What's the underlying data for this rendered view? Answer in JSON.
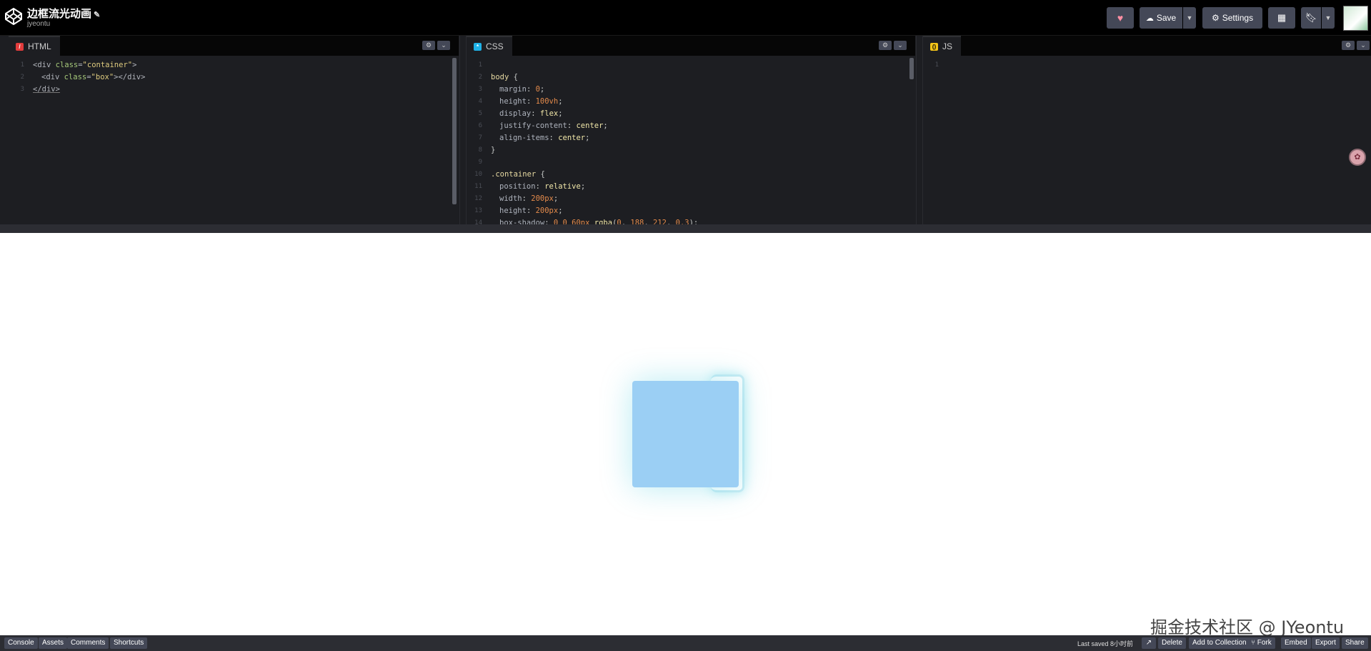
{
  "header": {
    "title": "边框流光动画",
    "author": "jyeontu",
    "save_label": "Save",
    "settings_label": "Settings"
  },
  "editors": {
    "html": {
      "label": "HTML",
      "lines": [
        "1",
        "2",
        "3"
      ]
    },
    "css": {
      "label": "CSS",
      "lines": [
        "1",
        "2",
        "3",
        "4",
        "5",
        "6",
        "7",
        "8",
        "9",
        "10",
        "11",
        "12",
        "13",
        "14"
      ]
    },
    "js": {
      "label": "JS",
      "lines": [
        "1"
      ]
    }
  },
  "preview": {
    "watermark": "掘金技术社区 @ JYeontu"
  },
  "footer": {
    "console": "Console",
    "assets": "Assets",
    "comments": "Comments",
    "shortcuts": "Shortcuts",
    "last_saved": "Last saved 8小时前",
    "delete": "Delete",
    "add_to_collection": "Add to Collection",
    "fork": "Fork",
    "embed": "Embed",
    "export": "Export",
    "share": "Share"
  },
  "colors": {
    "html_icon": "#e23c3c",
    "css_icon": "#1fb2e8",
    "js_icon": "#f5c518"
  }
}
